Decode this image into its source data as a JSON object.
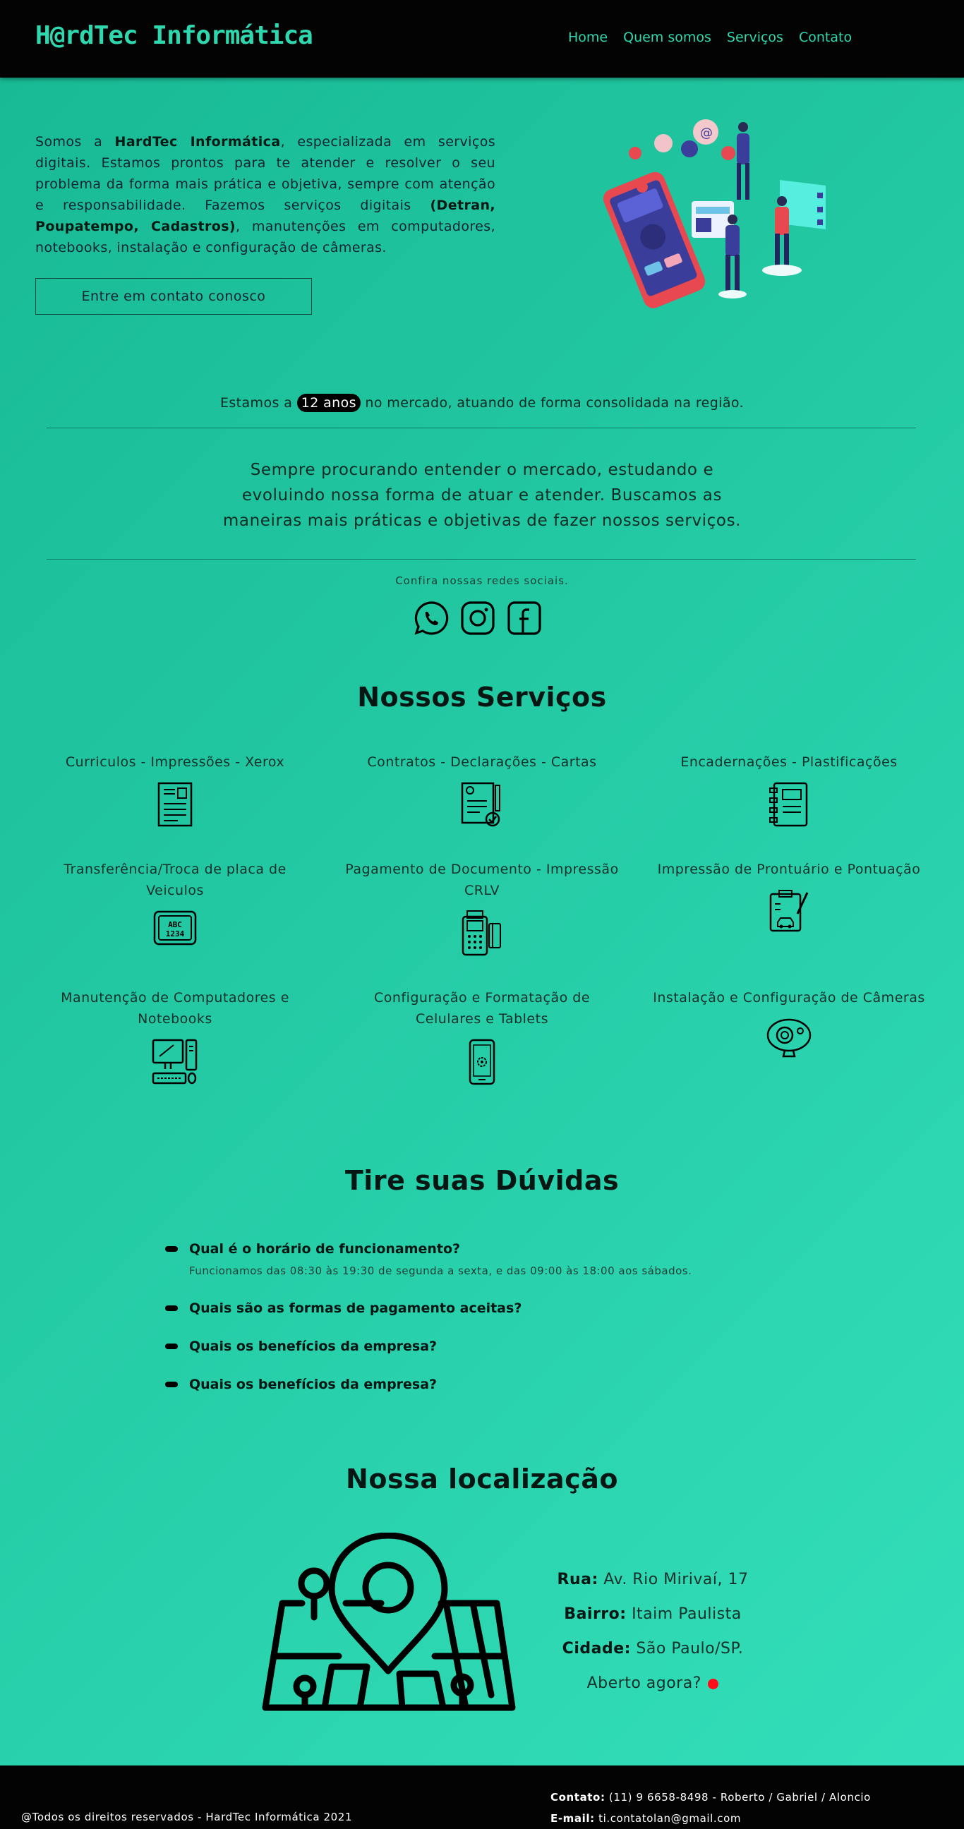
{
  "header": {
    "logo": "H@rdTec Informática",
    "nav": [
      "Home",
      "Quem somos",
      "Serviços",
      "Contato"
    ]
  },
  "intro": {
    "p1": "Somos a ",
    "brand": "HardTec Informática",
    "p2": ", especializada em serviços digitais. Estamos prontos para te atender e resolver o seu problema da forma mais prática e objetiva, sempre com atenção e responsabilidade. Fazemos serviços digitais ",
    "highlight": "(Detran, Poupatempo, Cadastros)",
    "p3": ", manutenções em computadores, notebooks, instalação e configuração de câmeras.",
    "cta": "Entre em contato conosco"
  },
  "about": {
    "years_before": "Estamos a ",
    "years_pill": "12 anos",
    "years_after": " no mercado, atuando de forma consolidada na região.",
    "mission": "Sempre procurando entender o mercado, estudando e evoluindo nossa forma de atuar e atender. Buscamos as maneiras mais práticas e objetivas de fazer nossos serviços.",
    "social_label": "Confira nossas redes sociais.",
    "social_icons": [
      "whatsapp-icon",
      "instagram-icon",
      "facebook-icon"
    ]
  },
  "services": {
    "title": "Nossos Serviços",
    "items": [
      {
        "label": "Curriculos - Impressões - Xerox",
        "icon": "resume-icon"
      },
      {
        "label": "Contratos - Declarações - Cartas",
        "icon": "contract-icon"
      },
      {
        "label": "Encadernações - Plastificações",
        "icon": "notebook-icon"
      },
      {
        "label": "Transferência/Troca de placa de Veiculos",
        "icon": "license-plate-icon"
      },
      {
        "label": "Pagamento de Documento - Impressão CRLV",
        "icon": "card-machine-icon"
      },
      {
        "label": "Impressão de Prontuário e Pontuação",
        "icon": "clipboard-car-icon"
      },
      {
        "label": "Manutenção de Computadores e Notebooks",
        "icon": "computer-icon"
      },
      {
        "label": "Configuração e Formatação de Celulares e Tablets",
        "icon": "smartphone-settings-icon"
      },
      {
        "label": "Instalação e Configuração de Câmeras",
        "icon": "webcam-icon"
      }
    ]
  },
  "faq": {
    "title": "Tire suas Dúvidas",
    "items": [
      {
        "q": "Qual é o horário de funcionamento?",
        "a": "Funcionamos das 08:30 às 19:30 de segunda a sexta, e das 09:00 às 18:00 aos sábados."
      },
      {
        "q": "Quais são as formas de pagamento aceitas?"
      },
      {
        "q": "Quais os benefícios da empresa?"
      },
      {
        "q": "Quais os benefícios da empresa?"
      }
    ]
  },
  "location": {
    "title": "Nossa localização",
    "street_label": "Rua:",
    "street": " Av. Rio Mirivaí, 17",
    "district_label": "Bairro:",
    "district": " Itaim Paulista",
    "city_label": "Cidade:",
    "city": " São Paulo/SP.",
    "open_text": "Aberto agora?",
    "open_status_color": "#ff0b1b"
  },
  "footer": {
    "copyright": "@Todos os direitos reservados - HardTec Informática 2021",
    "contact_label": "Contato:",
    "contact": " (11) 9 6658-8498 - Roberto / Gabriel / Aloncio",
    "email_label": "E-mail:",
    "email": " ti.contatolan@gmail.com"
  },
  "colors": {
    "accent": "#2fd7ae",
    "header_bg": "#030303",
    "bg_start": "#17b994",
    "bg_end": "#33e0bb"
  }
}
